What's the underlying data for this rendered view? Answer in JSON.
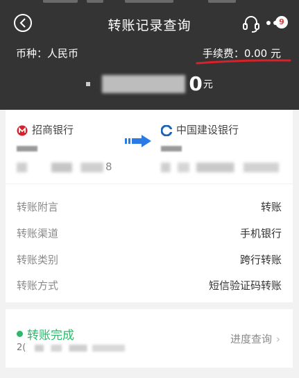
{
  "header": {
    "title": "转账记录查询",
    "badge_count": "9",
    "currency_label": "币种：人民币",
    "fee_label": "手续费：0.00 元",
    "amount_tail": "0",
    "amount_unit": "元",
    "underline_color": "#d8212b"
  },
  "accounts": {
    "from_bank": "招商银行",
    "from_account_tail": "8",
    "to_bank": "中国建设银行",
    "arrow_color": "#2c7be5"
  },
  "details": [
    {
      "label": "转账附言",
      "value": "转账"
    },
    {
      "label": "转账渠道",
      "value": "手机银行"
    },
    {
      "label": "转账类别",
      "value": "跨行转账"
    },
    {
      "label": "转账方式",
      "value": "短信验证码转账"
    }
  ],
  "status": {
    "text": "转账完成",
    "date_prefix": "2(",
    "progress_link": "进度查询",
    "status_color": "#2db86b"
  }
}
